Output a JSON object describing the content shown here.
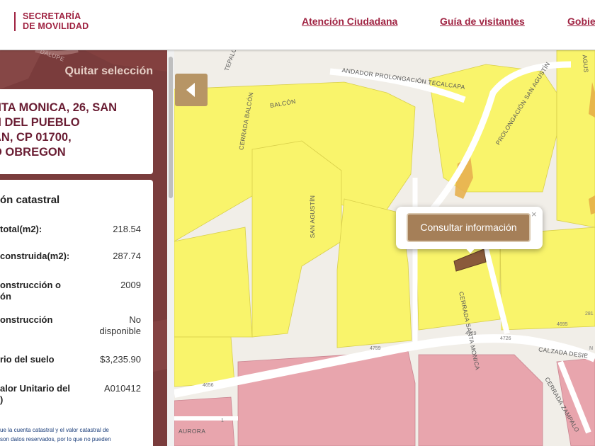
{
  "header": {
    "logo_line1": "SECRETARÍA",
    "logo_line2": "DE MOVILIDAD",
    "nav": [
      "Atención Ciudadana",
      "Guía de visitantes",
      "Gobie"
    ]
  },
  "panel": {
    "clear_selection": "Quitar selección",
    "address": [
      "NTA MONICA, 26, SAN",
      "N DEL PUEBLO",
      "AN, CP 01700,",
      "O OBREGON"
    ],
    "info_title": "ón catastral",
    "rows": [
      {
        "label": [
          "total(m2):"
        ],
        "value": [
          "218.54"
        ]
      },
      {
        "label": [
          "construida(m2):"
        ],
        "value": [
          "287.74"
        ]
      },
      {
        "label": [
          "onstrucción o",
          "ón"
        ],
        "value": [
          "2009"
        ]
      },
      {
        "label": [
          "onstrucción"
        ],
        "value": [
          "No",
          "disponible"
        ]
      },
      {
        "label": [
          "rio del suelo"
        ],
        "value": [
          "$3,235.90"
        ]
      },
      {
        "label": [
          "alor Unitario del",
          ")"
        ],
        "value": [
          "A010412"
        ]
      }
    ],
    "note": [
      "ue la cuenta catastral y el valor catastral de",
      " son datos reservados, por lo que no pueden"
    ]
  },
  "map": {
    "popup_button": "Consultar información",
    "popup_close": "×",
    "streets": {
      "andador": "ANDADOR PROLONGACIÓN TECALCAPA",
      "prolongacion": "PROLONGACIÓN SAN AGUSTÍN",
      "balcon": "BALCÓN",
      "cerrada_balcon": "CERRADA BALCÓN",
      "san_agustin": "SAN AGUSTÍN",
      "santa_monica": "CERRADA SANTA MONICA",
      "calzada": "CALZADA DESIE",
      "zampalo": "CERRADA ZAMPALO",
      "aurora": "AURORA",
      "tepalc": "TEPALC",
      "agus": "AGUS",
      "dalupe": "DALUPE"
    },
    "lots": [
      "4729",
      "4726",
      "4759",
      "4656",
      "4695",
      "1",
      "281",
      "N"
    ]
  },
  "colors": {
    "brand": "#9f2241",
    "panel_bg": "#7a3c3c",
    "button": "#a57f58",
    "parcel_yellow": "#f9f46b",
    "parcel_pink": "#e8a5ad",
    "selected_parcel": "#8a5a3b"
  }
}
